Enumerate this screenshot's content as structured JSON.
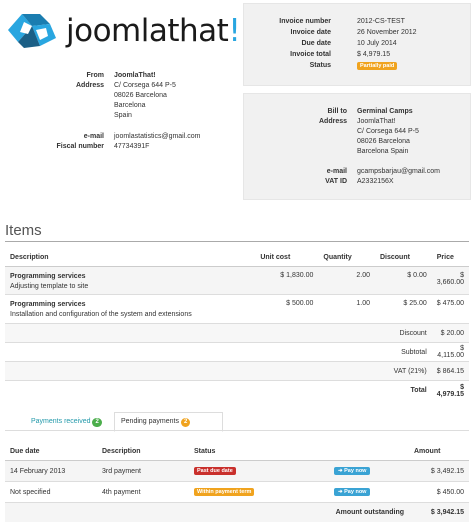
{
  "logo": {
    "word_main": "joomlathat",
    "word_accent": "!",
    "brand_color": "#29a6e0"
  },
  "invoice": {
    "number_label": "Invoice number",
    "number": "2012-CS-TEST",
    "date_label": "Invoice date",
    "date": "26 November 2012",
    "due_label": "Due date",
    "due": "10 July 2014",
    "total_label": "Invoice total",
    "total": "$ 4,979.15",
    "status_label": "Status",
    "status": "Partially paid"
  },
  "from": {
    "from_label": "From",
    "name": "JoomlaThat!",
    "address_label": "Address",
    "address": [
      "C/ Corsega 644 P-5",
      "08026 Barcelona",
      "Barcelona",
      "Spain"
    ],
    "email_label": "e-mail",
    "email": "joomlastatistics@gmail.com",
    "fiscal_label": "Fiscal number",
    "fiscal": "47734391F"
  },
  "bill_to": {
    "bill_label": "Bill to",
    "name": "Germinal Camps",
    "address_label": "Address",
    "address": [
      "JoomlaThat!",
      "C/ Corsega 644 P-5",
      "08026 Barcelona",
      "Barcelona Spain"
    ],
    "email_label": "e-mail",
    "email": "gcampsbarjau@gmail.com",
    "vat_label": "VAT ID",
    "vat": "A2332156X"
  },
  "items": {
    "title": "Items",
    "headers": {
      "description": "Description",
      "unit_cost": "Unit cost",
      "quantity": "Quantity",
      "discount": "Discount",
      "price": "Price"
    },
    "rows": [
      {
        "name": "Programming services",
        "detail": "Adjusting template to site",
        "unit_cost": "$ 1,830.00",
        "quantity": "2.00",
        "discount": "$ 0.00",
        "price": "$ 3,660.00"
      },
      {
        "name": "Programming services",
        "detail": "Installation and configuration of the system and extensions",
        "unit_cost": "$ 500.00",
        "quantity": "1.00",
        "discount": "$ 25.00",
        "price": "$ 475.00"
      }
    ],
    "summary": [
      {
        "label": "Discount",
        "value": "$ 20.00",
        "bold": false
      },
      {
        "label": "Subtotal",
        "value": "$ 4,115.00",
        "bold": false
      },
      {
        "label": "VAT (21%)",
        "value": "$ 864.15",
        "bold": false
      },
      {
        "label": "Total",
        "value": "$ 4,979.15",
        "bold": true
      }
    ]
  },
  "tabs": {
    "received_label": "Payments received",
    "received_count": "2",
    "pending_label": "Pending payments",
    "pending_count": "2"
  },
  "payments": {
    "headers": {
      "due": "Due date",
      "description": "Description",
      "status": "Status",
      "amount": "Amount"
    },
    "rows": [
      {
        "due": "14 February 2013",
        "description": "3rd payment",
        "status": "Past due date",
        "status_color": "#c9302c",
        "action": "Pay now",
        "amount": "$ 3,492.15"
      },
      {
        "due": "Not specified",
        "description": "4th payment",
        "status": "Within payment term",
        "status_color": "#f0a31e",
        "action": "Pay now",
        "amount": "$ 450.00"
      }
    ],
    "outstanding_label": "Amount outstanding",
    "outstanding": "$ 3,942.15"
  }
}
